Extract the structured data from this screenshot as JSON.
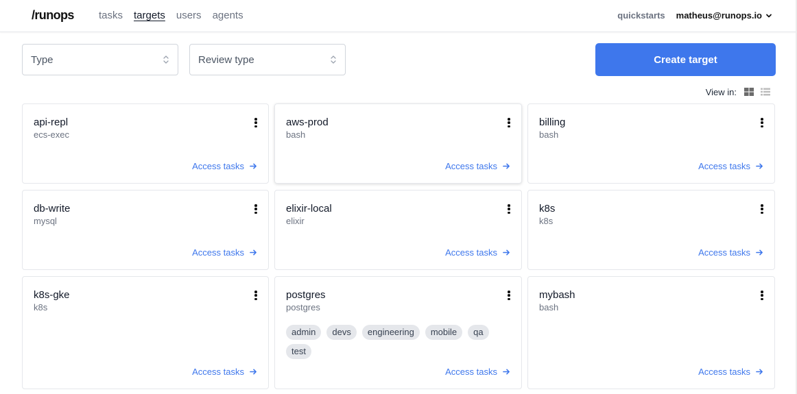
{
  "header": {
    "logo": "/runops",
    "nav": [
      {
        "label": "tasks",
        "active": false
      },
      {
        "label": "targets",
        "active": true
      },
      {
        "label": "users",
        "active": false
      },
      {
        "label": "agents",
        "active": false
      }
    ],
    "quickstarts": "quickstarts",
    "user_email": "matheus@runops.io"
  },
  "filters": {
    "type_placeholder": "Type",
    "review_type_placeholder": "Review type"
  },
  "actions": {
    "create_target": "Create target",
    "view_in_label": "View in:",
    "views": [
      "grid-view-icon",
      "list-view-icon"
    ],
    "active_view": "grid"
  },
  "colors": {
    "accent": "#3e77ec",
    "tag_bg": "#e5e7eb"
  },
  "targets": [
    {
      "name": "api-repl",
      "type": "ecs-exec",
      "tags": [],
      "link": "Access tasks"
    },
    {
      "name": "aws-prod",
      "type": "bash",
      "tags": [],
      "link": "Access tasks"
    },
    {
      "name": "billing",
      "type": "bash",
      "tags": [],
      "link": "Access tasks"
    },
    {
      "name": "db-write",
      "type": "mysql",
      "tags": [],
      "link": "Access tasks"
    },
    {
      "name": "elixir-local",
      "type": "elixir",
      "tags": [],
      "link": "Access tasks"
    },
    {
      "name": "k8s",
      "type": "k8s",
      "tags": [],
      "link": "Access tasks"
    },
    {
      "name": "k8s-gke",
      "type": "k8s",
      "tags": [],
      "link": "Access tasks"
    },
    {
      "name": "postgres",
      "type": "postgres",
      "tags": [
        "admin",
        "devs",
        "engineering",
        "mobile",
        "qa",
        "test"
      ],
      "link": "Access tasks"
    },
    {
      "name": "mybash",
      "type": "bash",
      "tags": [],
      "link": "Access tasks"
    }
  ]
}
